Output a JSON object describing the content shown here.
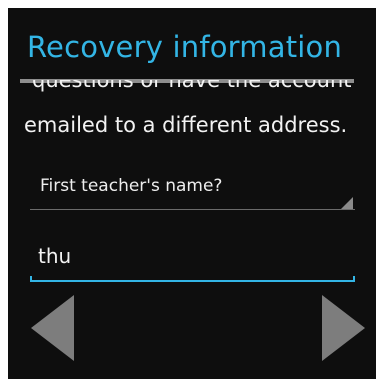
{
  "header": {
    "title": "Recovery information"
  },
  "description": {
    "clipped_line": "questions or have the account",
    "visible_line": "emailed to a different address."
  },
  "form": {
    "security_question": "First teacher's name?",
    "answer_value": "thu"
  },
  "navigation": {
    "prev_icon": "arrow-left-icon",
    "next_icon": "arrow-right-icon"
  },
  "colors": {
    "accent": "#33b5e5",
    "background": "#0e0e0e"
  }
}
